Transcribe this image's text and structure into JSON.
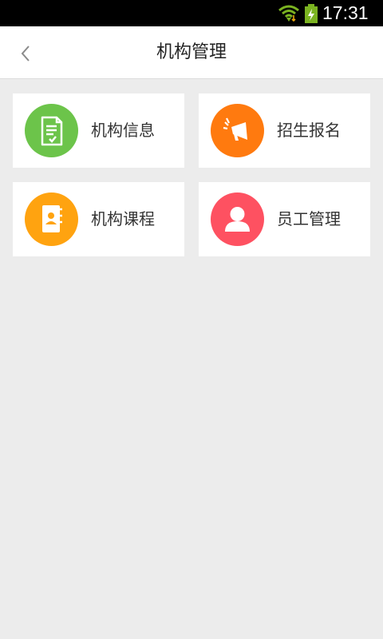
{
  "status_bar": {
    "time": "17:31",
    "icons": [
      "wifi-icon",
      "battery-charging-icon"
    ]
  },
  "header": {
    "title": "机构管理",
    "back_icon": "chevron-left-icon"
  },
  "menu": {
    "items": [
      {
        "label": "机构信息",
        "icon": "document-check-icon",
        "color": "#6cc44a"
      },
      {
        "label": "招生报名",
        "icon": "megaphone-icon",
        "color": "#ff7a0f"
      },
      {
        "label": "机构课程",
        "icon": "contact-book-icon",
        "color": "#ffa310"
      },
      {
        "label": "员工管理",
        "icon": "person-icon",
        "color": "#fe5161"
      }
    ]
  }
}
